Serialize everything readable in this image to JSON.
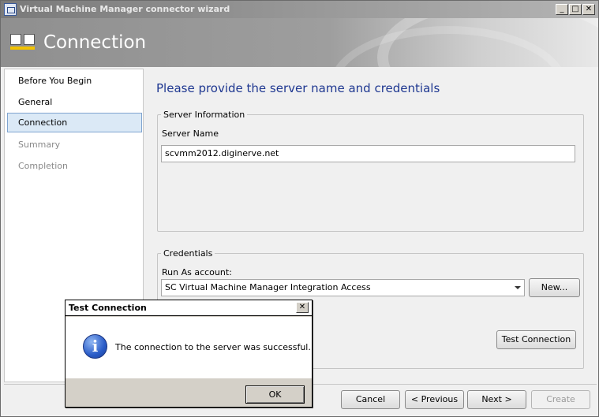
{
  "window": {
    "title": "Virtual Machine Manager connector wizard",
    "controls": {
      "minimize": "_",
      "maximize": "□",
      "close": "✕"
    }
  },
  "header": {
    "title": "Connection",
    "icon": "connection-icon"
  },
  "nav": {
    "items": [
      {
        "label": "Before You Begin",
        "state": "normal"
      },
      {
        "label": "General",
        "state": "normal"
      },
      {
        "label": "Connection",
        "state": "selected"
      },
      {
        "label": "Summary",
        "state": "disabled"
      },
      {
        "label": "Completion",
        "state": "disabled"
      }
    ]
  },
  "content": {
    "heading": "Please provide the server name and credentials",
    "server_info": {
      "legend": "Server Information",
      "server_name_label": "Server Name",
      "server_name_value": "scvmm2012.diginerve.net"
    },
    "credentials": {
      "legend": "Credentials",
      "run_as_label": "Run As account:",
      "run_as_value": "SC Virtual Machine Manager Integration Access",
      "new_button": "New...",
      "test_button": "Test Connection"
    }
  },
  "footer": {
    "cancel": "Cancel",
    "previous": "< Previous",
    "next": "Next >",
    "create": "Create"
  },
  "dialog": {
    "title": "Test Connection",
    "close": "✕",
    "icon": "info-icon",
    "message": "The connection to the server was successful.",
    "ok": "OK"
  }
}
